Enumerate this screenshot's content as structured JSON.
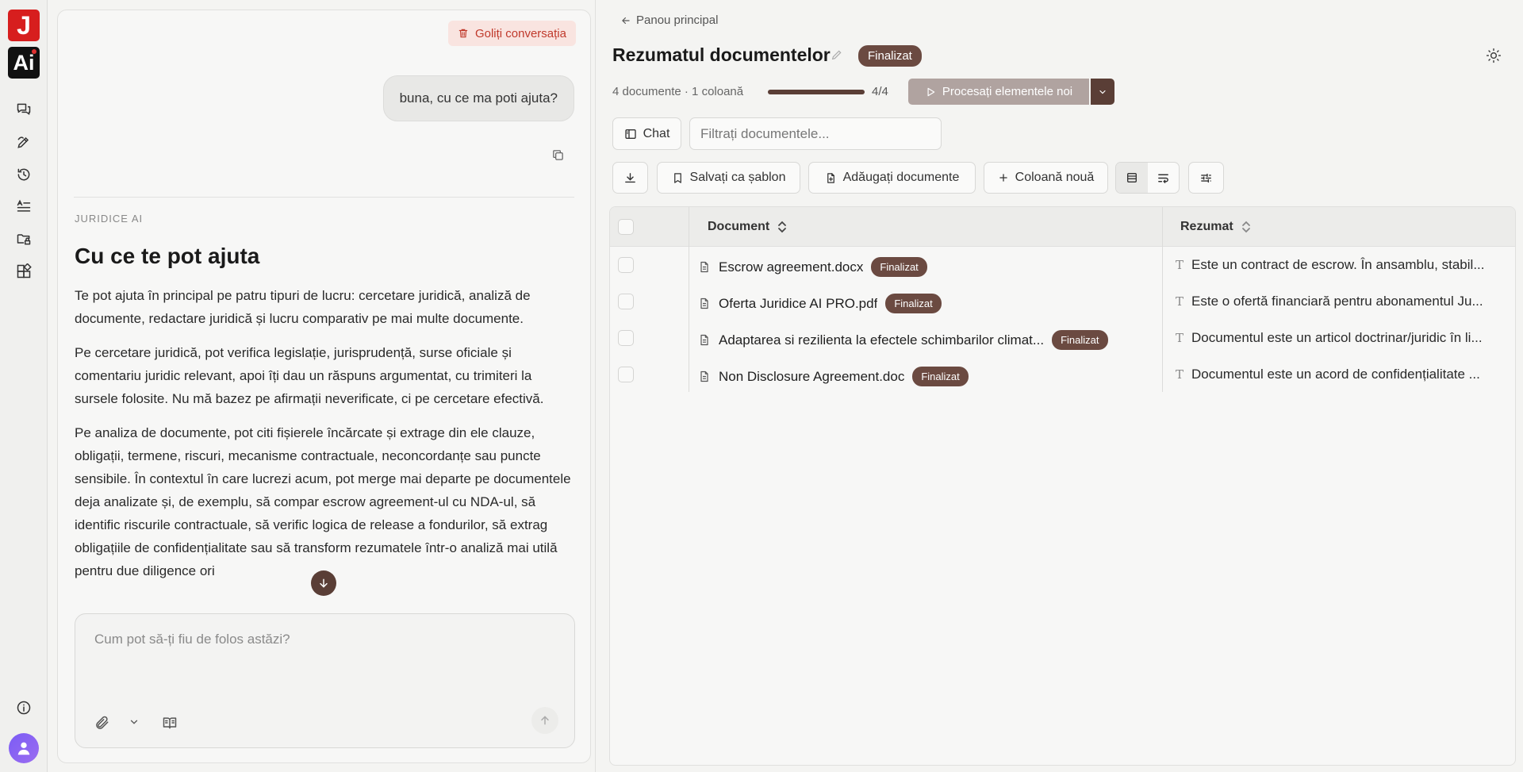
{
  "chat": {
    "clear_label": "Goliți conversația",
    "user_message": "buna, cu ce ma poti ajuta?",
    "ai_label": "JURIDICE AI",
    "ai_heading": "Cu ce te pot ajuta",
    "ai_paragraphs": [
      "Te pot ajuta în principal pe patru tipuri de lucru: cercetare juridică, analiză de documente, redactare juridică și lucru comparativ pe mai multe documente.",
      "Pe cercetare juridică, pot verifica legislație, jurisprudență, surse oficiale și comentariu juridic relevant, apoi îți dau un răspuns argumentat, cu trimiteri la sursele folosite. Nu mă bazez pe afirmații neverificate, ci pe cercetare efectivă.",
      "Pe analiza de documente, pot citi fișierele încărcate și extrage din ele clauze, obligații, termene, riscuri, mecanisme contractuale, neconcordanțe sau puncte sensibile. În contextul în care lucrezi acum, pot merge mai departe pe documentele deja analizate și, de exemplu, să compar escrow agreement-ul cu NDA-ul, să identific riscurile contractuale, să verific logica de release a fondurilor, să extrag obligațiile de confidențialitate sau să transform rezumatele într-o analiză mai utilă pentru due diligence ori"
    ],
    "input_placeholder": "Cum pot să-ți fiu de folos astăzi?"
  },
  "header": {
    "back_label": "Panou principal",
    "title": "Rezumatul documentelor",
    "status": "Finalizat",
    "meta": "4 documente · 1 coloană",
    "progress": 1.0,
    "progress_label": "4/4",
    "process_label": "Procesați elementele noi"
  },
  "toolbar": {
    "chat_label": "Chat",
    "filter_placeholder": "Filtrați documentele...",
    "save_template_label": "Salvați ca șablon",
    "add_documents_label": "Adăugați documente",
    "new_column_label": "Coloană nouă"
  },
  "table": {
    "columns": [
      "Document",
      "Rezumat"
    ],
    "rows": [
      {
        "document": "Escrow agreement.docx",
        "status": "Finalizat",
        "summary": "Este un contract de escrow. În ansamblu, stabil..."
      },
      {
        "document": "Oferta Juridice AI PRO.pdf",
        "status": "Finalizat",
        "summary": "Este o ofertă financiară pentru abonamentul Ju..."
      },
      {
        "document": "Adaptarea si rezilienta la efectele schimbarilor climat...",
        "status": "Finalizat",
        "summary": "Documentul este un articol doctrinar/juridic în li..."
      },
      {
        "document": "Non Disclosure Agreement.doc",
        "status": "Finalizat",
        "summary": "Documentul este un acord de confidențialitate ..."
      }
    ]
  },
  "icons": {
    "sidebar": [
      "chat-icon",
      "draft-icon",
      "history-icon",
      "text-list-icon",
      "folder-lock-icon",
      "apps-icon",
      "info-icon",
      "user-avatar-icon"
    ],
    "theme": "sun-icon"
  },
  "colors": {
    "brand_red": "#d71e1e",
    "badge_brown": "#6b4a41",
    "process_disabled": "#b0a3a0",
    "danger": "#c0392b"
  }
}
